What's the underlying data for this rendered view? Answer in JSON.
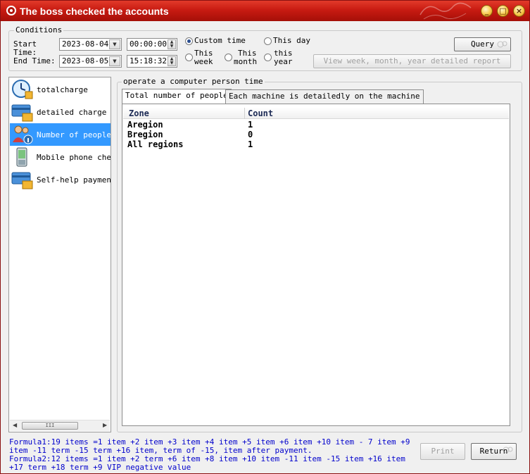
{
  "window": {
    "title": "The boss checked the accounts",
    "controls": {
      "minimize": "_",
      "maximize": "□",
      "close": "×"
    }
  },
  "conditions": {
    "caption": "Conditions",
    "start_label": "Start\nTime:",
    "start_label_line1": "Start",
    "start_label_line2": "Time:",
    "end_label": "End Time:",
    "start_date": "2023-08-04",
    "start_time": "00:00:00",
    "end_date": "2023-08-05",
    "end_time": "15:18:32",
    "radios": {
      "custom_time": {
        "label": "Custom time",
        "checked": true
      },
      "this_day": {
        "label": "This day",
        "checked": false
      },
      "this_week": {
        "line1": "This",
        "line2": "week",
        "checked": false
      },
      "this_month": {
        "line1": "This",
        "line2": "month",
        "checked": false
      },
      "this_year": {
        "line1": "this",
        "line2": "year",
        "checked": false
      }
    },
    "query_button": "Query",
    "detail_button": "View week, month, year detailed report"
  },
  "nav": {
    "items": [
      {
        "label": "totalcharge",
        "icon": "clock-coins-icon",
        "selected": false
      },
      {
        "label": "detailed charge",
        "icon": "card-coins-icon",
        "selected": false
      },
      {
        "label": "Number of people o",
        "icon": "people-info-icon",
        "selected": true
      },
      {
        "label": "Mobile phone check",
        "icon": "mobile-phone-icon",
        "selected": false
      },
      {
        "label": "Self-help payment",
        "icon": "card-coins-icon",
        "selected": false
      }
    ],
    "scroll_left": "◀",
    "scroll_right": "▶",
    "scroll_grip": "III"
  },
  "main": {
    "caption": "operate a computer person time",
    "tabs": [
      {
        "label": "Total number of people",
        "active": true
      },
      {
        "label": "Each machine is detailedly on the machine",
        "active": false
      }
    ],
    "table": {
      "columns": [
        "Zone",
        "Count"
      ],
      "rows": [
        [
          "Aregion",
          "1"
        ],
        [
          "Bregion",
          "0"
        ],
        [
          "All regions",
          "1"
        ]
      ]
    }
  },
  "footer": {
    "formula1_line1": "Formula1:19 items =1 item +2 item +3 item +4 item +5 item +6 item +10 item - 7 item +9",
    "formula1_line2": "item -11 term -15 term +16 item, term of -15, item after payment.",
    "formula2_line1": "Formula2:12 items =1 item +2 term +6 item +8 item +10 item -11 item -15 item +16 item",
    "formula2_line2": "+17 term +18 term +9 VIP negative value",
    "print_button": "Print",
    "return_button": "Return"
  },
  "colors": {
    "title_bar": "#c81b12",
    "selection": "#3399ff",
    "formula_text": "#0000cc"
  }
}
